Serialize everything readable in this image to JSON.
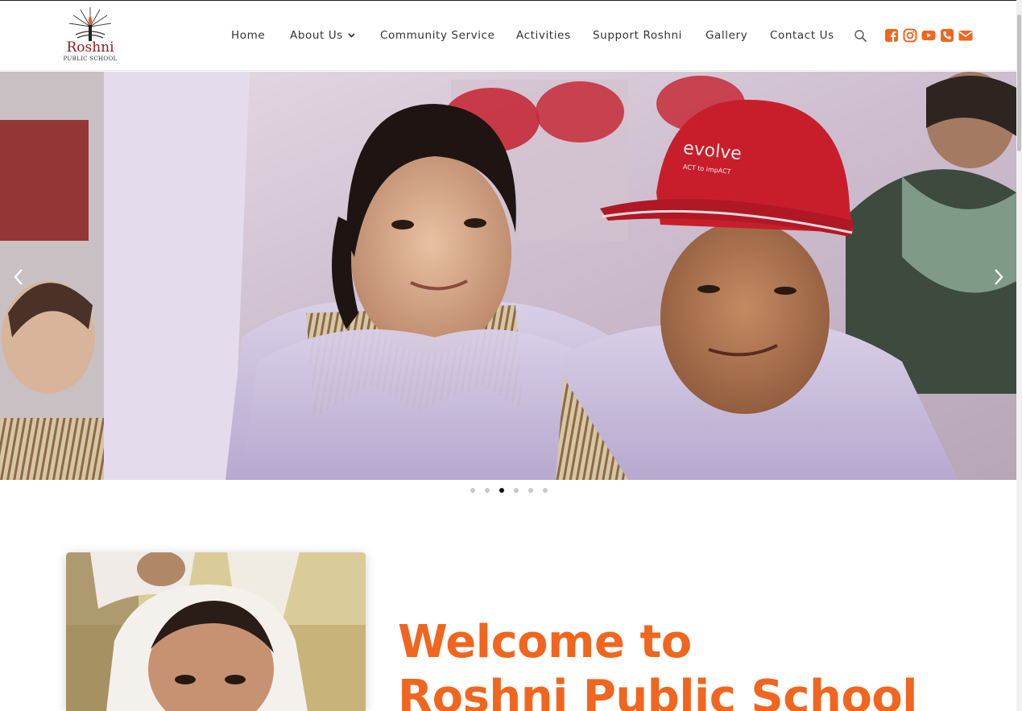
{
  "header": {
    "logo_title": "Roshni",
    "logo_subtitle": "PUBLIC SCHOOL",
    "nav": [
      {
        "label": "Home"
      },
      {
        "label": "About Us"
      },
      {
        "label": "Community Service"
      },
      {
        "label": "Activities"
      },
      {
        "label": "Support Roshni"
      },
      {
        "label": "Gallery"
      },
      {
        "label": "Contact Us"
      }
    ],
    "social_icons": [
      "facebook-icon",
      "instagram-icon",
      "youtube-icon",
      "phone-icon",
      "email-icon"
    ]
  },
  "slider": {
    "slide_count": 6,
    "active_slide": 3,
    "cap_text": "evolve",
    "cap_subtext": "ACT to impACT"
  },
  "welcome": {
    "title_line1": "Welcome to",
    "title_line2": "Roshni Public School"
  },
  "colors": {
    "accent": "#f0661f",
    "logo_red": "#8a1c1c",
    "cap_red": "#c81e2b"
  }
}
